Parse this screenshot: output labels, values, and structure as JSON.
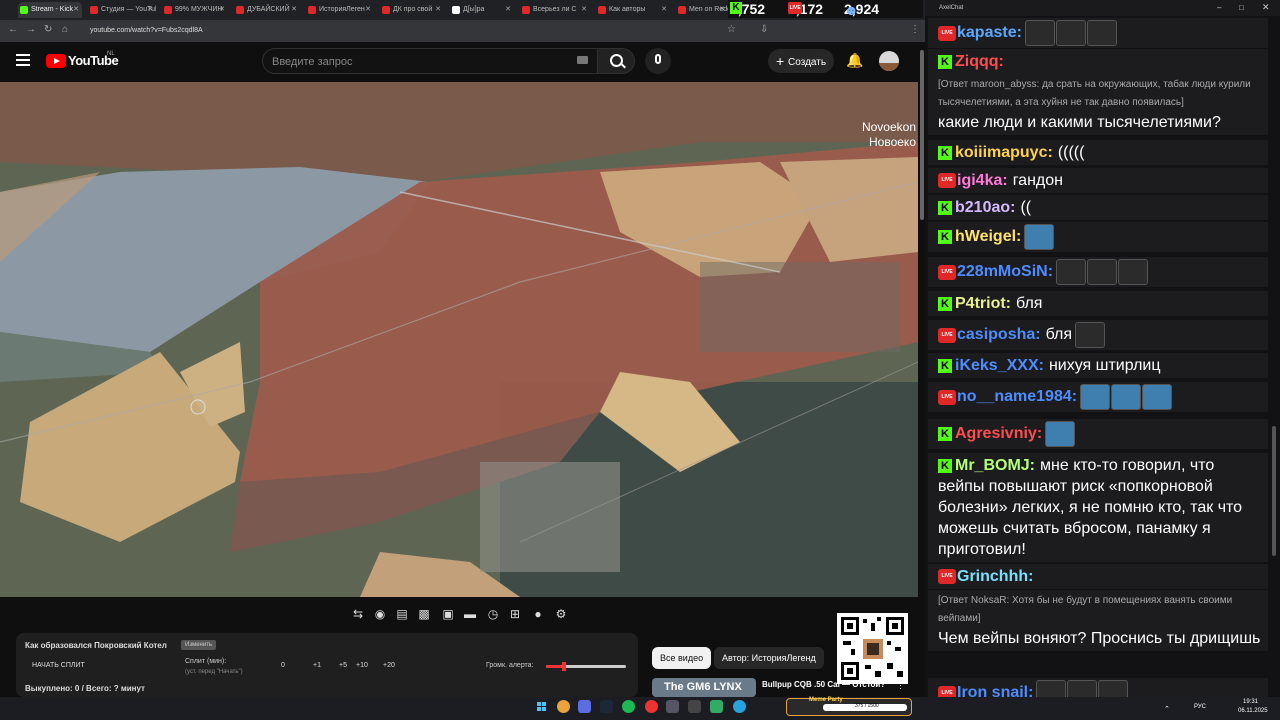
{
  "browser": {
    "tabs": [
      {
        "label": "Stream - Kick",
        "color": "#53fc18"
      },
      {
        "label": "Студия — YouTube",
        "color": "#e02828"
      },
      {
        "label": "99% МУЖЧИН",
        "color": "#e02828"
      },
      {
        "label": "ДУБАЙСКИЙ",
        "color": "#e02828"
      },
      {
        "label": "ИсторияЛеген",
        "color": "#e02828"
      },
      {
        "label": "ДК про свой",
        "color": "#e02828"
      },
      {
        "label": "Д[ы]ра",
        "color": "#ffffff"
      },
      {
        "label": "Всерьез ли С",
        "color": "#e02828"
      },
      {
        "label": "Как авторы",
        "color": "#e02828"
      },
      {
        "label": "Men on Reddit",
        "color": "#e02828"
      }
    ],
    "url": "youtube.com/watch?v=Fubs2cqdl8A"
  },
  "stream_stats": {
    "kick_viewers": "1,752",
    "yt_viewers": "1,172",
    "total_viewers": "2,924"
  },
  "youtube": {
    "logo_text": "YouTube",
    "region": "NL",
    "search_placeholder": "Введите запрос",
    "create_label": "Создать"
  },
  "video": {
    "place_label_latin": "Novoekon",
    "place_label_cyrillic": "Новоеко"
  },
  "split_panel": {
    "title": "Как образовался Покровский Котел",
    "change_label": "Изменить",
    "start_label": "НАЧАТЬ СПЛИТ",
    "split_label": "Сплит (мин):",
    "split_hint": "(уст. перед \"Начать\")",
    "split_value": "0",
    "increments": [
      "+1",
      "+5",
      "+10",
      "+20"
    ],
    "alert_volume_label": "Громк. алерта:",
    "alert_volume_level": 0.2,
    "done_label": "Выкуплено: 0 / Всего: ? минут"
  },
  "recommendations": {
    "chips": [
      "Все видео",
      "Автор: ИсторияЛегенд"
    ],
    "preview_title": "Bullpup CQB .50 Cal — Отстой?",
    "preview_thumb_text": "The GM6 LYNX"
  },
  "taskbar": {
    "widget_text": "Meme Party",
    "progress_text": "375 / 1500",
    "lang": "РУС",
    "time": "19:31",
    "date": "06.11.2025"
  },
  "chat": {
    "window_title": "AxelChat",
    "messages": [
      {
        "platform": "yt",
        "nick": "kapaste:",
        "nick_color": "#5aa9ff",
        "text": "",
        "emotes": 3
      },
      {
        "platform": "k",
        "nick": "Ziqqq:",
        "nick_color": "#ff4d4d",
        "text": "",
        "emotes": 0
      },
      {
        "platform": "reply",
        "reply": "[Ответ maroon_abyss: да срать на окружающих, табак люди курили тысячелетиями, а эта хуйня не так давно появилась]",
        "text": "какие люди и какими тысячелетиями?"
      },
      {
        "platform": "k",
        "nick": "koiiimapuyc:",
        "nick_color": "#ffd24d",
        "text": "(((((",
        "emotes": 0
      },
      {
        "platform": "yt",
        "nick": "igi4ka:",
        "nick_color": "#ff7ad9",
        "text": "гандон",
        "emotes": 0
      },
      {
        "platform": "k",
        "nick": "b210ao:",
        "nick_color": "#d6b8ff",
        "text": "((",
        "emotes": 0
      },
      {
        "platform": "k",
        "nick": "hWeigel:",
        "nick_color": "#ffe36a",
        "text": "",
        "emotes": 1
      },
      {
        "platform": "yt",
        "nick": "228mMoSiN:",
        "nick_color": "#4d8dff",
        "text": "",
        "emotes": 3
      },
      {
        "platform": "k",
        "nick": "P4triot:",
        "nick_color": "#e8f08c",
        "text": "бля",
        "emotes": 0
      },
      {
        "platform": "yt",
        "nick": "casiposha:",
        "nick_color": "#4d8dff",
        "text": "бля",
        "emotes": 1
      },
      {
        "platform": "k",
        "nick": "iKeks_XXX:",
        "nick_color": "#4d8dff",
        "text": "нихуя штирлиц",
        "emotes": 0
      },
      {
        "platform": "yt",
        "nick": "no__name1984:",
        "nick_color": "#4d8dff",
        "text": "",
        "emotes": 3
      },
      {
        "platform": "k",
        "nick": "Agresivniy:",
        "nick_color": "#ff4d4d",
        "text": "",
        "emotes": 1
      },
      {
        "platform": "k",
        "nick": "Mr_BOMJ:",
        "nick_color": "#b6ff7a",
        "text": "мне кто-то говорил, что вейпы повышают риск «попкорновой болезни» легких, я не помню кто, так что можешь считать вбросом, панамку я приготовил!",
        "emotes": 0
      },
      {
        "platform": "yt",
        "nick": "Grinchhh:",
        "nick_color": "#7ae0ff",
        "text": "",
        "emotes": 0
      },
      {
        "platform": "reply",
        "reply": "[Ответ NoksaR: Хотя бы не будут в помещениях ванять своими вейпами]",
        "text": "Чем вейпы воняют? Проснись ты дрищишь"
      },
      {
        "platform": "yt",
        "nick": "Iron snail:",
        "nick_color": "#4d8dff",
        "text": "",
        "emotes": 3
      }
    ]
  }
}
